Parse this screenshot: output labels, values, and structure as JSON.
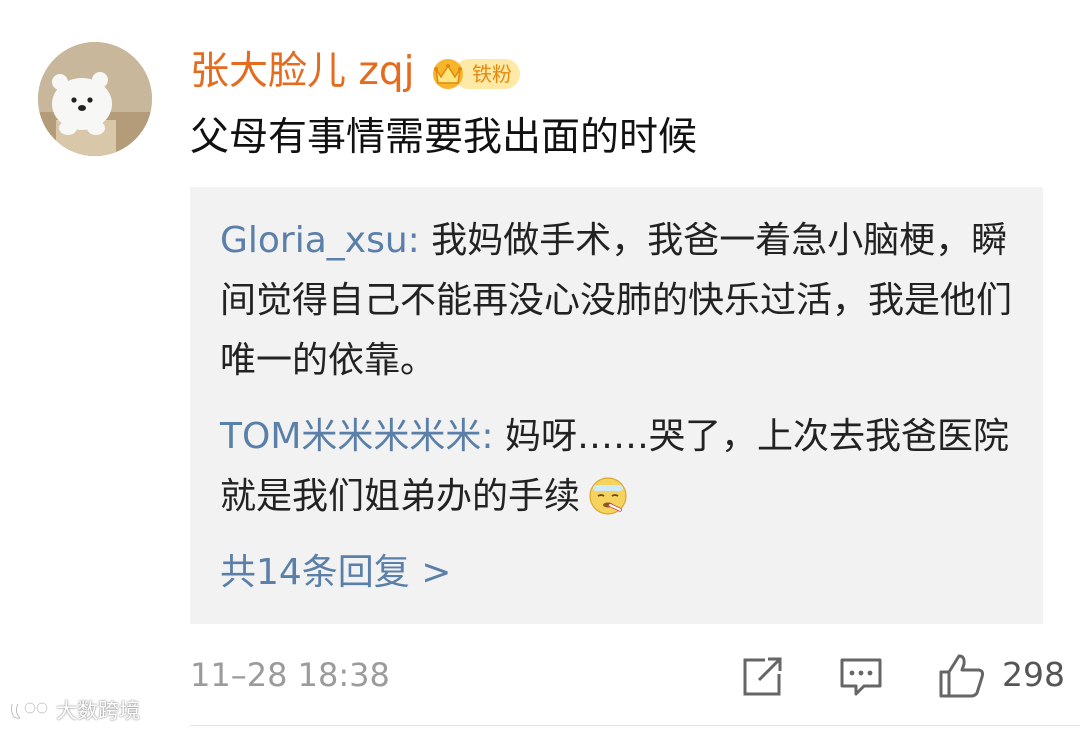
{
  "comment": {
    "username": "张大脸儿 zqj",
    "badge": {
      "label": "铁粉",
      "level": "2",
      "icon": "crown-icon",
      "color": "#e48a10"
    },
    "text": "父母有事情需要我出面的时候",
    "avatar_icon": "polar-bear-avatar"
  },
  "replies": [
    {
      "author": "Gloria_xsu",
      "separator": ": ",
      "text": "我妈做手术，我爸一着急小脑梗，瞬间觉得自己不能再没心没肺的快乐过活，我是他们唯一的依靠。"
    },
    {
      "author": "TOM米米米米米",
      "separator": ": ",
      "text": "妈呀……哭了，上次去我爸医院就是我们姐弟办的手续",
      "emoji": "sick-thermometer-emoji"
    }
  ],
  "more_replies": "共14条回复 >",
  "footer": {
    "timestamp": "11–28 18:38",
    "like_count": "298",
    "icons": [
      "repost-icon",
      "comment-icon",
      "thumbs-up-icon"
    ]
  },
  "watermark": {
    "text": "大数跨境",
    "logo": "watermark-logo-icon"
  },
  "colors": {
    "username": "#e46c1e",
    "link": "#5a7fa8",
    "reply_bg": "#f2f2f2",
    "meta": "#9b9b9b"
  }
}
